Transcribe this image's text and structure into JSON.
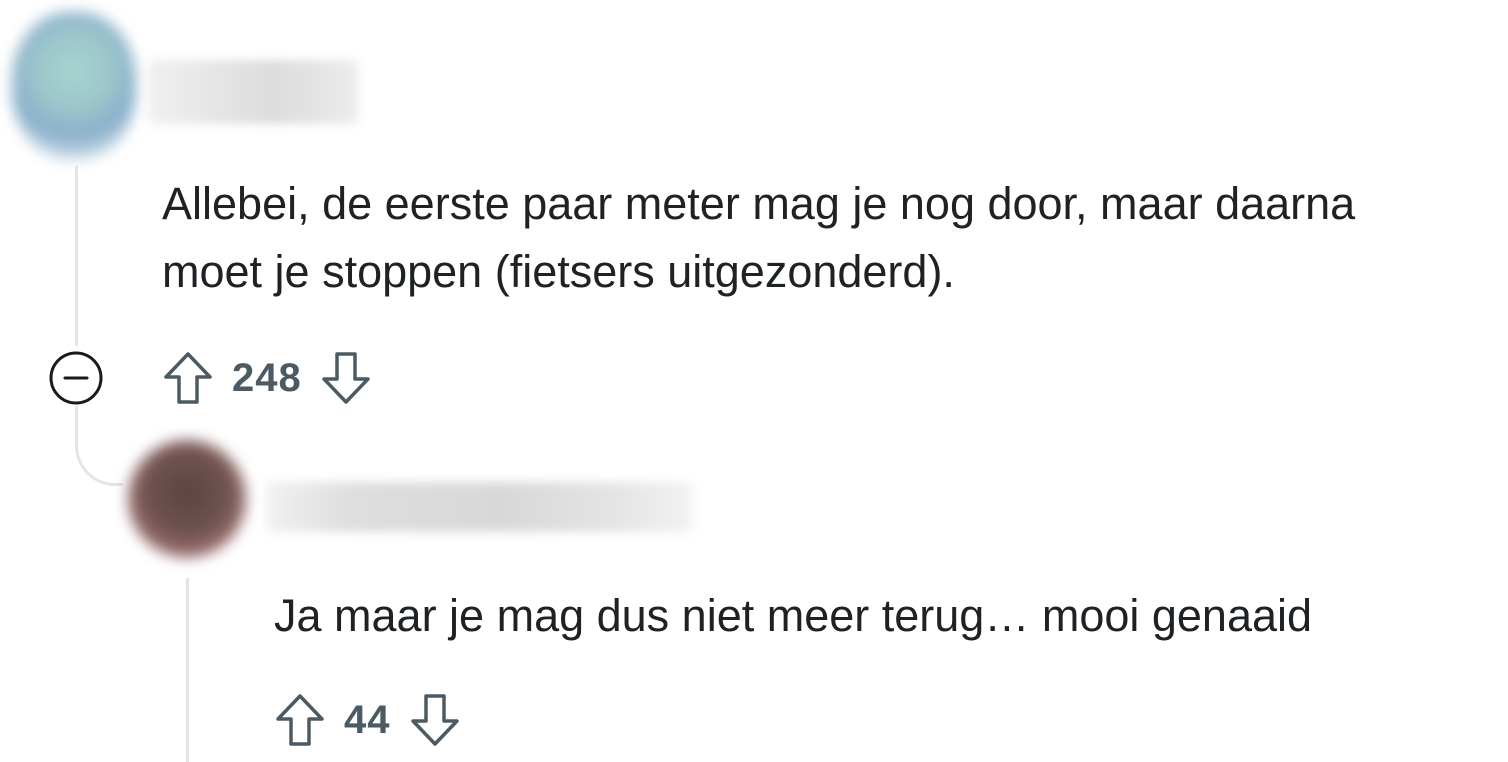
{
  "comments": [
    {
      "avatar_icon": "user-avatar-blurred",
      "username": "",
      "body_lines": [
        "Allebei, de eerste paar meter mag je nog door, maar daarna",
        "moet je stoppen (fietsers uitgezonderd)."
      ],
      "score": "248",
      "collapse_icon": "minus-circle-icon",
      "upvote_icon": "arrow-up-outline-icon",
      "downvote_icon": "arrow-down-outline-icon"
    },
    {
      "avatar_icon": "user-avatar-blurred",
      "username": "",
      "body": "Ja maar je mag dus niet meer terug… mooi genaaid",
      "score": "44",
      "upvote_icon": "arrow-up-outline-icon",
      "downvote_icon": "arrow-down-outline-icon"
    }
  ],
  "colors": {
    "text": "#1f2224",
    "meta": "#4c5a63",
    "thread_line": "#e3e5e7",
    "background": "#ffffff"
  }
}
